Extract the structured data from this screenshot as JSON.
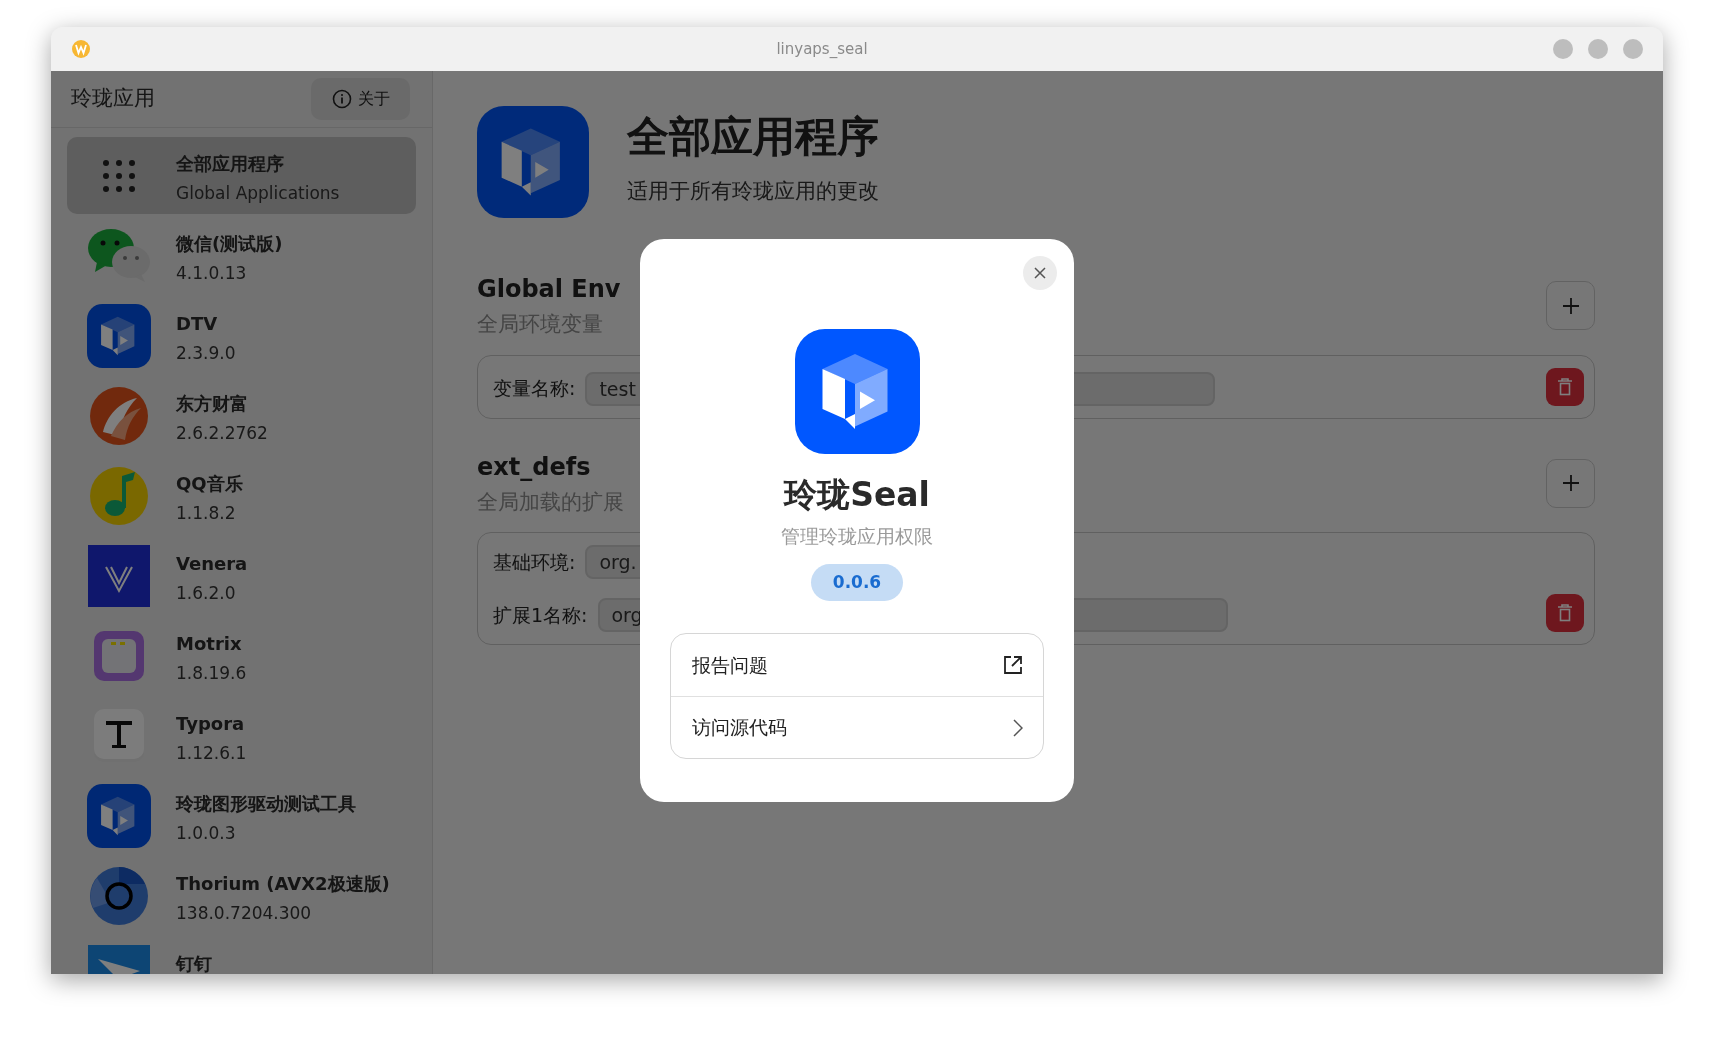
{
  "window": {
    "title": "linyaps_seal"
  },
  "sidebar": {
    "title": "玲珑应用",
    "about_button": "关于",
    "items": [
      {
        "title": "全部应用程序",
        "subtitle": "Global Applications",
        "selected": true
      },
      {
        "title": "微信(测试版)",
        "subtitle": "4.1.0.13",
        "selected": false
      },
      {
        "title": "DTV",
        "subtitle": "2.3.9.0",
        "selected": false
      },
      {
        "title": "东方财富",
        "subtitle": "2.6.2.2762",
        "selected": false
      },
      {
        "title": "QQ音乐",
        "subtitle": "1.1.8.2",
        "selected": false
      },
      {
        "title": "Venera",
        "subtitle": "1.6.2.0",
        "selected": false
      },
      {
        "title": "Motrix",
        "subtitle": "1.8.19.6",
        "selected": false
      },
      {
        "title": "Typora",
        "subtitle": "1.12.6.1",
        "selected": false
      },
      {
        "title": "玲珑图形驱动测试工具",
        "subtitle": "1.0.0.3",
        "selected": false
      },
      {
        "title": "Thorium (AVX2极速版)",
        "subtitle": "138.0.7204.300",
        "selected": false
      },
      {
        "title": "钉钉",
        "selected": false
      }
    ]
  },
  "header": {
    "title": "全部应用程序",
    "subtitle": "适用于所有玲珑应用的更改"
  },
  "sections": [
    {
      "title": "Global Env",
      "subtitle": "全局环境变量",
      "entries": [
        {
          "fields": [
            {
              "label": "变量名称:",
              "value": "test"
            }
          ]
        }
      ]
    },
    {
      "title": "ext_defs",
      "subtitle": "全局加载的扩展",
      "entries": [
        {
          "fields": [
            {
              "label": "基础环境:",
              "value": "org."
            },
            {
              "label": "扩展1名称:",
              "value": "org"
            }
          ]
        }
      ]
    }
  ],
  "dialog": {
    "title": "玲珑Seal",
    "subtitle": "管理玲珑应用权限",
    "version": "0.0.6",
    "links": [
      {
        "label": "报告问题",
        "kind": "external"
      },
      {
        "label": "访问源代码",
        "kind": "navigate"
      }
    ]
  }
}
